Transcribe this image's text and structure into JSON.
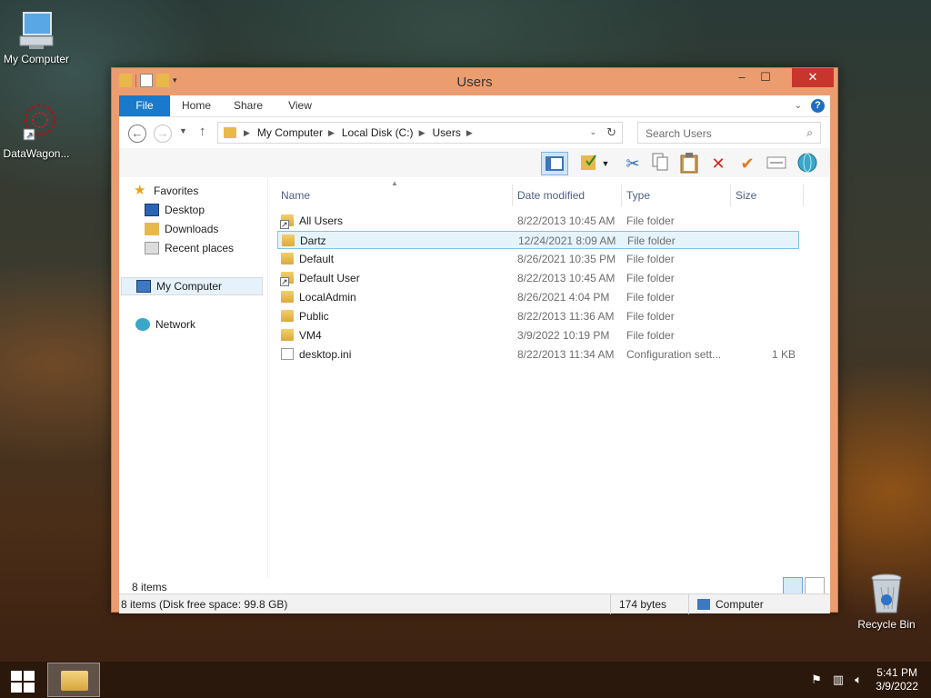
{
  "desktop": {
    "icons": [
      {
        "label": "My Computer"
      },
      {
        "label": "DataWagon..."
      },
      {
        "label": "Recycle Bin"
      }
    ]
  },
  "window": {
    "title": "Users",
    "ribbon_tabs": [
      "File",
      "Home",
      "Share",
      "View"
    ],
    "address": {
      "crumbs": [
        "My Computer",
        "Local Disk (C:)",
        "Users"
      ]
    },
    "search": {
      "placeholder": "Search Users"
    },
    "nav_pane": {
      "favorites": "Favorites",
      "desktop": "Desktop",
      "downloads": "Downloads",
      "recent": "Recent places",
      "my_computer": "My Computer",
      "network": "Network"
    },
    "columns": {
      "name": "Name",
      "date": "Date modified",
      "type": "Type",
      "size": "Size"
    },
    "files": [
      {
        "name": "All Users",
        "date": "8/22/2013 10:45 AM",
        "type": "File folder",
        "size": "",
        "icon": "shortcut-folder-icon"
      },
      {
        "name": "Dartz",
        "date": "12/24/2021 8:09 AM",
        "type": "File folder",
        "size": "",
        "icon": "folder-icon"
      },
      {
        "name": "Default",
        "date": "8/26/2021 10:35 PM",
        "type": "File folder",
        "size": "",
        "icon": "folder-icon"
      },
      {
        "name": "Default User",
        "date": "8/22/2013 10:45 AM",
        "type": "File folder",
        "size": "",
        "icon": "shortcut-folder-icon"
      },
      {
        "name": "LocalAdmin",
        "date": "8/26/2021 4:04 PM",
        "type": "File folder",
        "size": "",
        "icon": "folder-icon"
      },
      {
        "name": "Public",
        "date": "8/22/2013 11:36 AM",
        "type": "File folder",
        "size": "",
        "icon": "folder-icon"
      },
      {
        "name": "VM4",
        "date": "3/9/2022 10:19 PM",
        "type": "File folder",
        "size": "",
        "icon": "folder-icon"
      },
      {
        "name": "desktop.ini",
        "date": "8/22/2013 11:34 AM",
        "type": "Configuration sett...",
        "size": "1 KB",
        "icon": "ini-file-icon"
      }
    ],
    "item_count": "8 items",
    "status": {
      "left": "8 items (Disk free space: 99.8 GB)",
      "mid": "174 bytes",
      "right": "Computer"
    }
  },
  "taskbar": {
    "time": "5:41 PM",
    "date": "3/9/2022"
  }
}
